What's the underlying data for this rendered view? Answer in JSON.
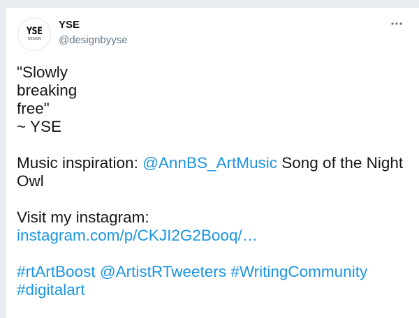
{
  "user": {
    "display_name": "YSE",
    "handle": "@designbyyse",
    "avatar_text": "YSE",
    "avatar_subtext": "DESIGN"
  },
  "menu": {
    "more_icon": "more-horizontal-icon"
  },
  "tweet": {
    "quote_line1": "\"Slowly",
    "quote_line2": "breaking",
    "quote_line3": "free\"",
    "signature": "~ YSE",
    "music_prefix": "Music inspiration: ",
    "music_mention": "@AnnBS_ArtMusic",
    "music_suffix": " Song of the Night",
    "music_suffix2": "Owl",
    "instagram_label": "Visit my instagram:",
    "instagram_link": "instagram.com/p/CKJI2G2Booq/…",
    "hashtag1": "#rtArtBoost",
    "mention2": "@ArtistRTweeters",
    "hashtag2": "#WritingCommunity",
    "hashtag3": "#digitalart"
  },
  "colors": {
    "link": "#1b95e0",
    "text": "#14171a",
    "secondary": "#657786"
  }
}
